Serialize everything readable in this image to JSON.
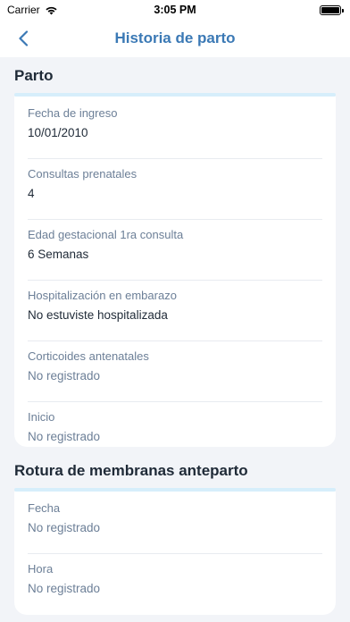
{
  "status_bar": {
    "carrier": "Carrier",
    "time": "3:05 PM",
    "battery_level": 1.0
  },
  "nav": {
    "title": "Historia de parto",
    "back_icon": "chevron-left-icon"
  },
  "sections": [
    {
      "title": "Parto",
      "fields": [
        {
          "label": "Fecha de ingreso",
          "value": "10/01/2010"
        },
        {
          "label": "Consultas prenatales",
          "value": "4"
        },
        {
          "label": "Edad gestacional 1ra consulta",
          "value": "6 Semanas"
        },
        {
          "label": "Hospitalización en embarazo",
          "value": "No estuviste hospitalizada"
        },
        {
          "label": "Corticoides antenatales",
          "value": "No registrado"
        },
        {
          "label": "Inicio",
          "value": "No registrado"
        }
      ]
    },
    {
      "title": "Rotura de membranas anteparto",
      "fields": [
        {
          "label": "Fecha",
          "value": "No registrado"
        },
        {
          "label": "Hora",
          "value": "No registrado"
        }
      ]
    }
  ],
  "colors": {
    "accent": "#3b79b5",
    "label": "#6c7f97",
    "rule": "#d6eefb",
    "background": "#f2f4f8"
  }
}
